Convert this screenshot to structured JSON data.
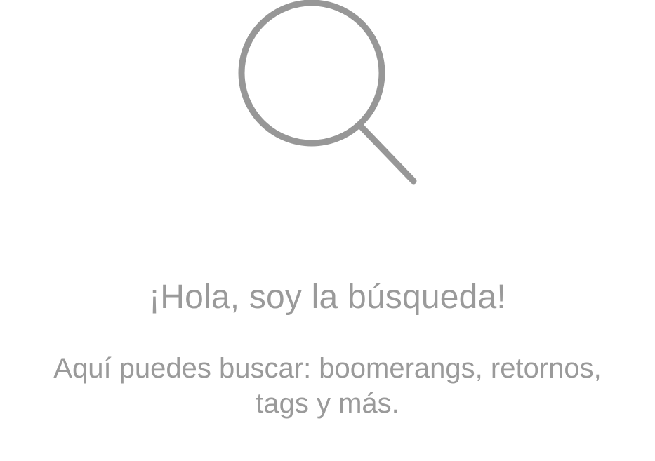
{
  "empty_state": {
    "icon": "search-icon",
    "title": "¡Hola, soy la búsqueda!",
    "subtitle": "Aquí puedes buscar: boomerangs, retornos, tags y más."
  },
  "colors": {
    "icon_stroke": "#979797",
    "text": "#9a9a9a",
    "background": "#ffffff"
  }
}
